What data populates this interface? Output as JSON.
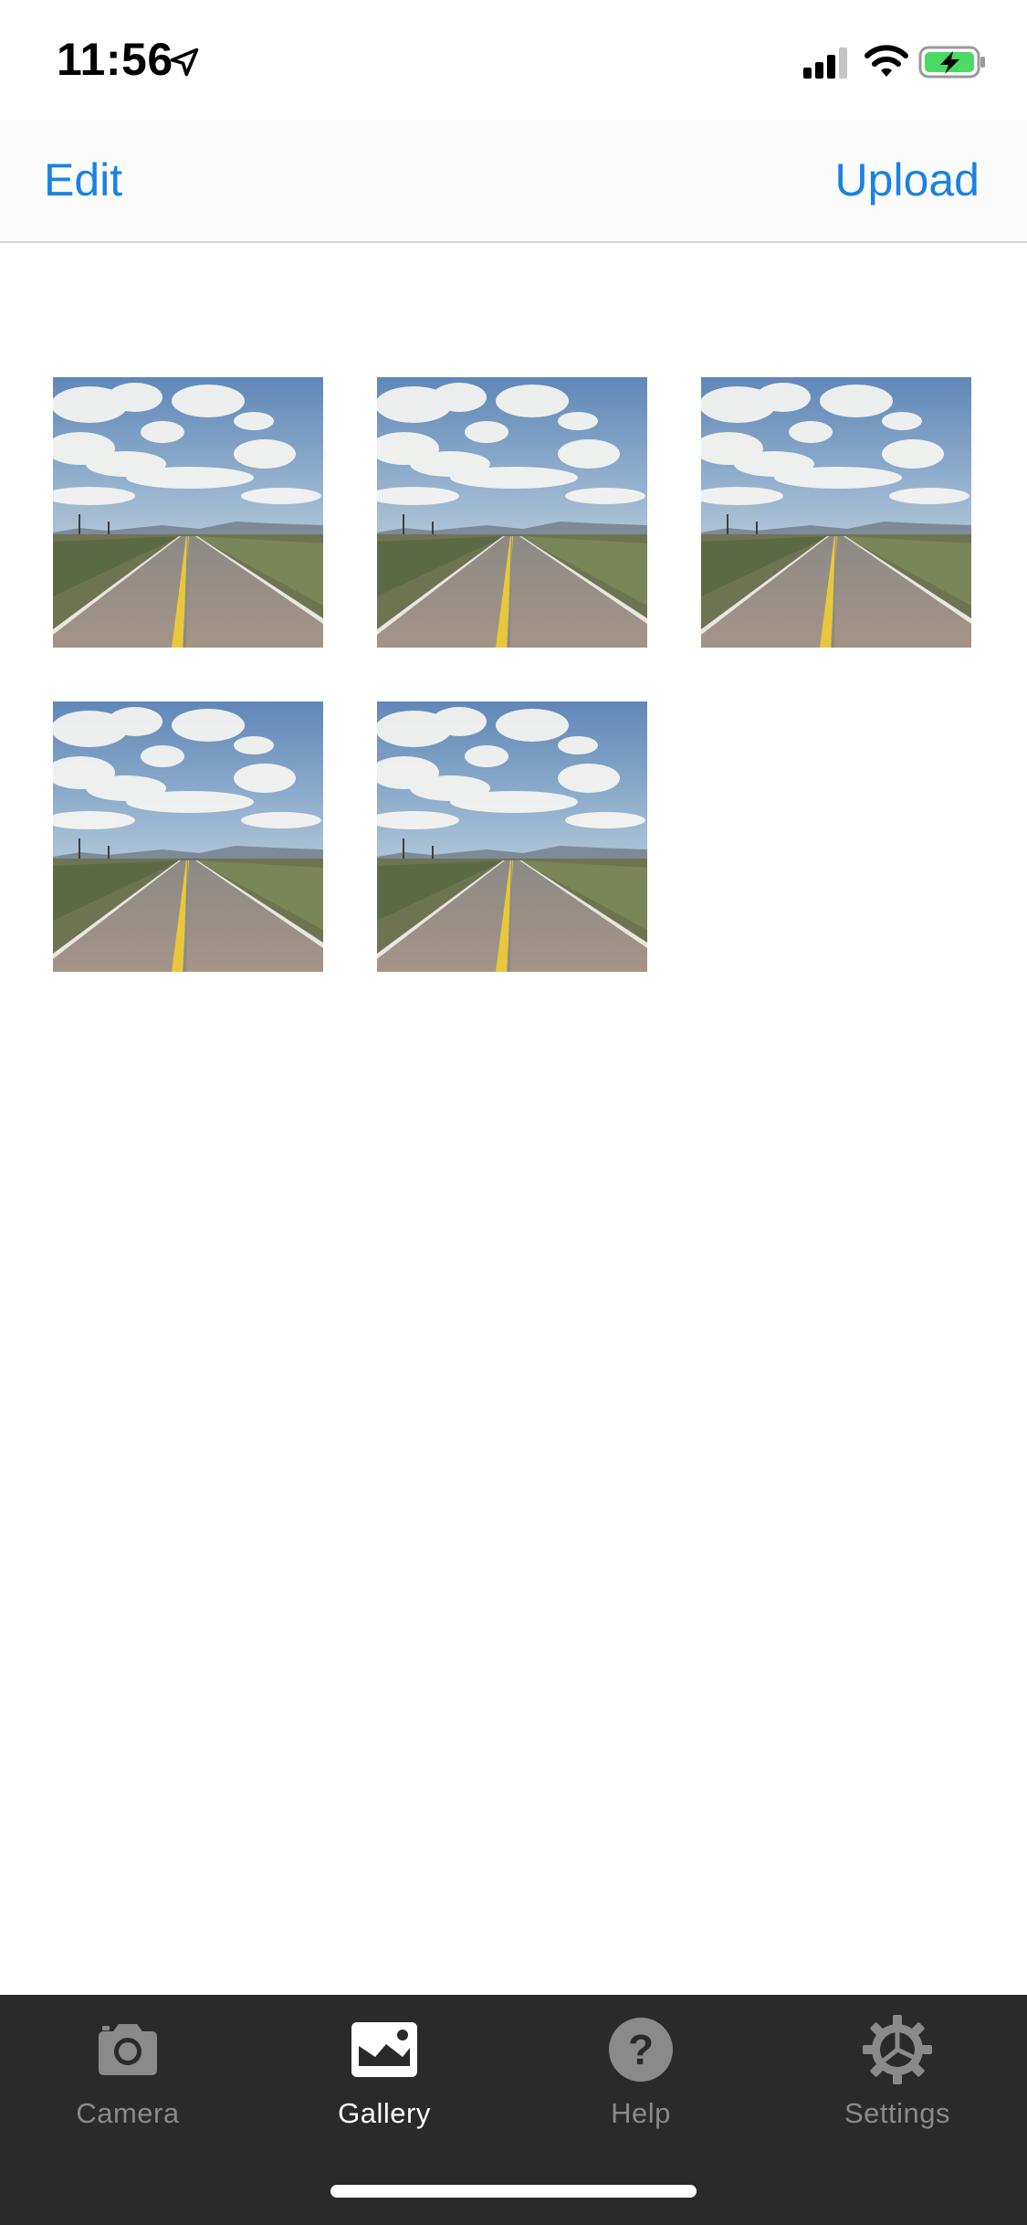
{
  "status_bar": {
    "time": "11:56",
    "icons": [
      "location-arrow-icon",
      "cellular-signal-icon",
      "wifi-icon",
      "battery-charging-icon"
    ],
    "battery_color": "#4cd964"
  },
  "nav": {
    "left_label": "Edit",
    "right_label": "Upload",
    "accent_color": "#1a82e2"
  },
  "gallery": {
    "photos": [
      {
        "subject": "desert-road-photo"
      },
      {
        "subject": "desert-road-photo"
      },
      {
        "subject": "desert-road-photo"
      },
      {
        "subject": "desert-road-photo"
      },
      {
        "subject": "desert-road-photo"
      }
    ]
  },
  "tabs": [
    {
      "label": "Camera",
      "icon": "camera-icon",
      "active": false
    },
    {
      "label": "Gallery",
      "icon": "gallery-icon",
      "active": true
    },
    {
      "label": "Help",
      "icon": "help-icon",
      "active": false
    },
    {
      "label": "Settings",
      "icon": "gear-icon",
      "active": false
    }
  ]
}
